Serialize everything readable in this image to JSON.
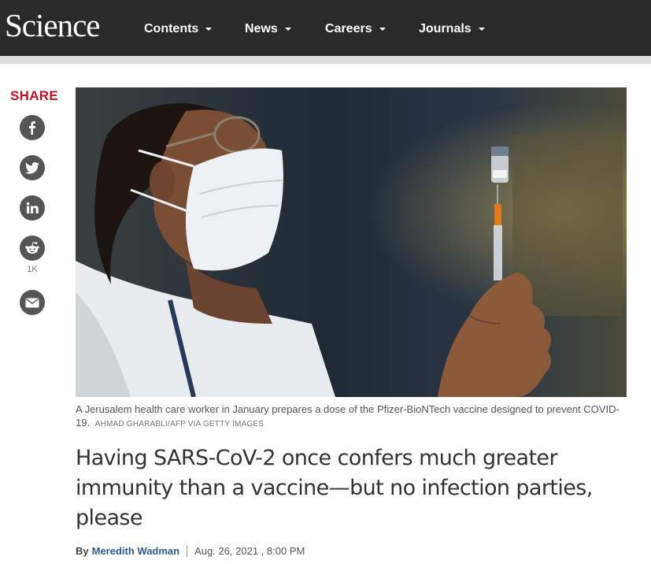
{
  "header": {
    "logo": "Science",
    "nav": [
      {
        "label": "Contents"
      },
      {
        "label": "News"
      },
      {
        "label": "Careers"
      },
      {
        "label": "Journals"
      }
    ]
  },
  "share": {
    "title": "SHARE",
    "reddit_count": "1K",
    "icons": [
      "facebook-icon",
      "twitter-icon",
      "linkedin-icon",
      "reddit-icon",
      "email-icon"
    ]
  },
  "article": {
    "caption": "A Jerusalem health care worker in January prepares a dose of the Pfizer-BioNTech vaccine designed to prevent COVID-19.",
    "credit": "AHMAD GHARABLI/AFP VIA GETTY IMAGES",
    "headline": "Having SARS-CoV-2 once confers much greater immunity than a vaccine—but no infection parties, please",
    "byline": {
      "by": "By",
      "author": "Meredith Wadman",
      "date": "Aug. 26, 2021 , 8:00 PM"
    }
  },
  "colors": {
    "topbar": "#2a2a2a",
    "share_accent": "#c0111f",
    "author_link": "#2d5c8f",
    "share_button": "#555555"
  }
}
